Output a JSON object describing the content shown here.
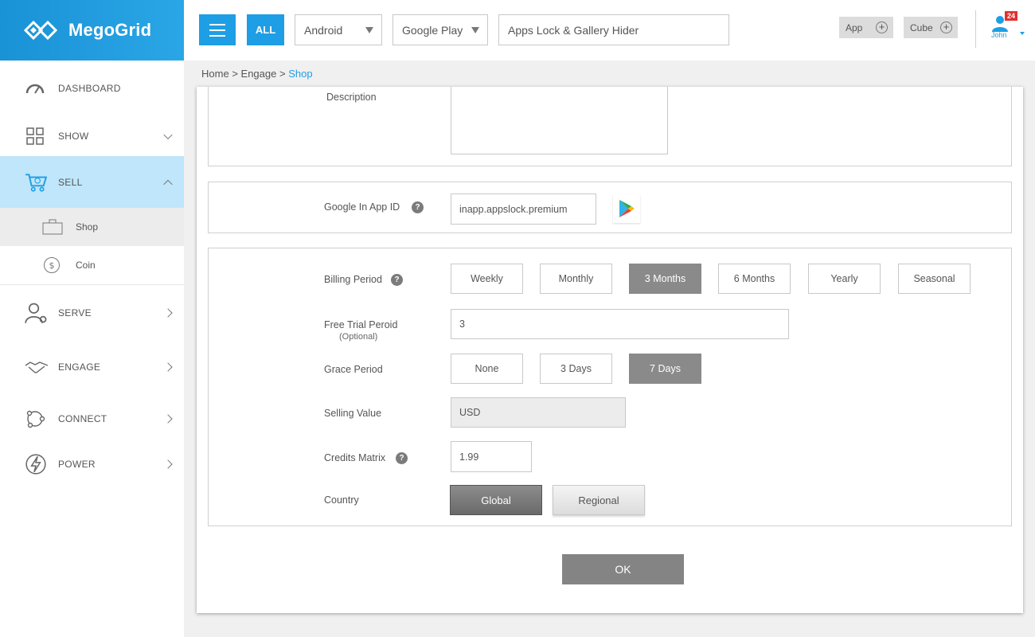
{
  "brand": {
    "name": "MegoGrid"
  },
  "topbar": {
    "all_label": "ALL",
    "platform": "Android",
    "store": "Google Play",
    "app_name": "Apps Lock & Gallery Hider",
    "app_button": "App",
    "cube_button": "Cube",
    "user_name": "John",
    "notification_count": "24"
  },
  "sidebar": {
    "items": [
      {
        "label": "DASHBOARD"
      },
      {
        "label": "SHOW"
      },
      {
        "label": "SELL"
      },
      {
        "label": "SERVE"
      },
      {
        "label": "ENGAGE"
      },
      {
        "label": "CONNECT"
      },
      {
        "label": "POWER"
      }
    ],
    "sell_sub": [
      {
        "label": "Shop"
      },
      {
        "label": "Coin"
      }
    ]
  },
  "breadcrumb": {
    "home": "Home",
    "sep": ">",
    "engage": "Engage",
    "current": "Shop"
  },
  "form": {
    "description_label": "Description",
    "google_id_label": "Google In App ID",
    "google_id_value": "inapp.appslock.premium",
    "billing_label": "Billing Period",
    "billing_options": [
      "Weekly",
      "Monthly",
      "3 Months",
      "6 Months",
      "Yearly",
      "Seasonal"
    ],
    "billing_selected": "3 Months",
    "free_trial_label": "Free Trial Peroid",
    "free_trial_sub": "(Optional)",
    "free_trial_value": "3",
    "grace_label": "Grace Period",
    "grace_options": [
      "None",
      "3 Days",
      "7 Days"
    ],
    "grace_selected": "7 Days",
    "selling_label": "Selling Value",
    "selling_value": "USD",
    "credits_label": "Credits Matrix",
    "credits_value": "1.99",
    "country_label": "Country",
    "country_global": "Global",
    "country_regional": "Regional",
    "ok_label": "OK"
  },
  "colors": {
    "accent": "#1e9ee4",
    "selected": "#8a8a8a",
    "sidebar_active": "#bfe6fa"
  }
}
